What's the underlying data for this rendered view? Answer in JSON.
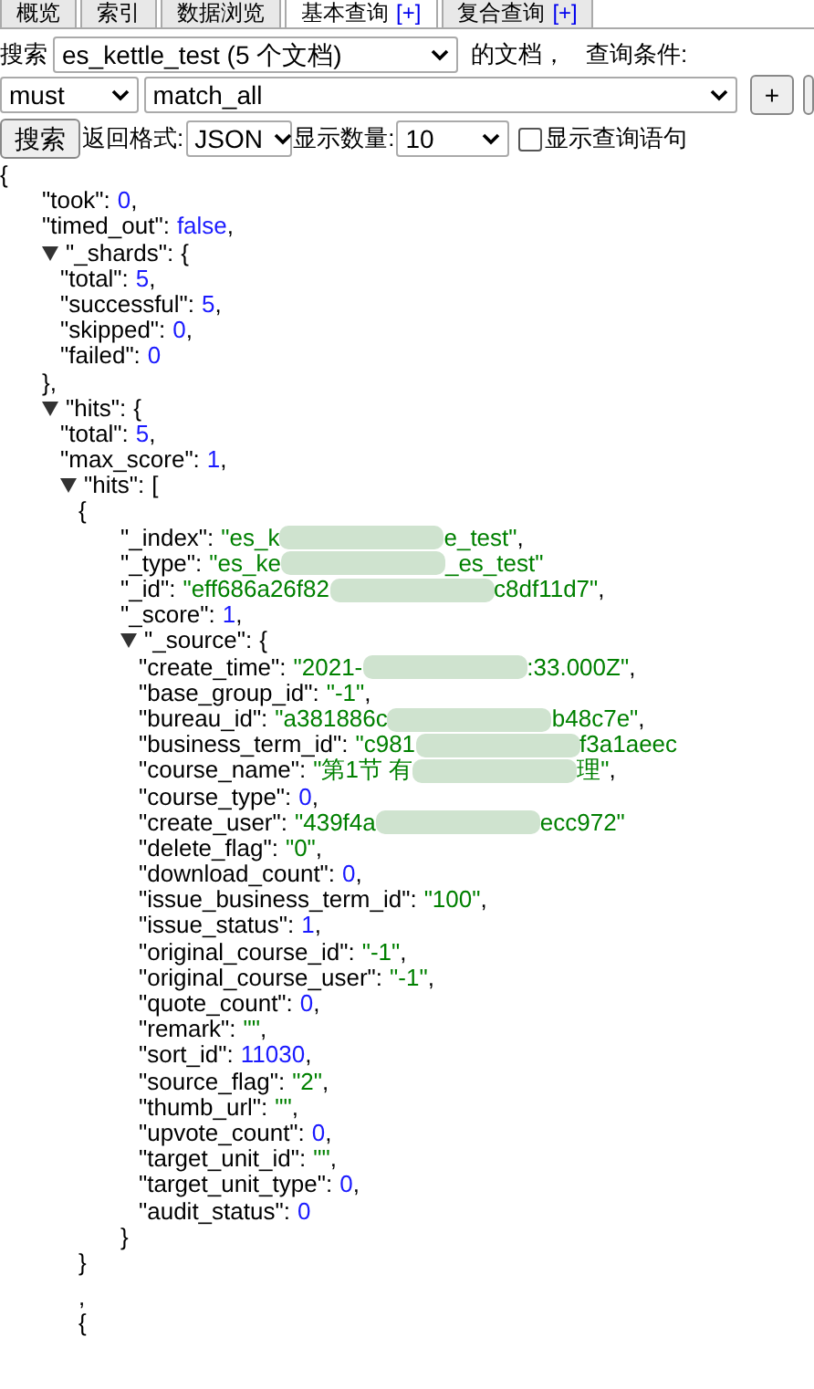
{
  "tabs": [
    {
      "label": "概览",
      "selected": false
    },
    {
      "label": "索引",
      "selected": false
    },
    {
      "label": "数据浏览",
      "selected": false
    },
    {
      "label": "基本查询",
      "plus": "[+]",
      "selected": true
    },
    {
      "label": "复合查询",
      "plus": "[+]",
      "selected": false
    }
  ],
  "search_row": {
    "label": "搜索",
    "index_select": "es_kettle_test (5 个文档)",
    "suffix": "的文档，",
    "condition_label": "查询条件:"
  },
  "condition_row": {
    "occur_select": "must",
    "query_select": "match_all",
    "add_button": "+"
  },
  "options_row": {
    "search_button": "搜索",
    "format_label": "返回格式:",
    "format_select": "JSON",
    "size_label": "显示数量:",
    "size_select": "10",
    "show_query": {
      "label": "显示查询语句",
      "checked": false
    }
  },
  "result": {
    "kind": "object",
    "open": "{",
    "children": [
      {
        "kind": "number",
        "key": "\"took\":",
        "value": "0",
        "after": ","
      },
      {
        "kind": "boolean",
        "key": "\"timed_out\":",
        "value": "false",
        "after": ","
      },
      {
        "kind": "object",
        "key": "\"_shards\":",
        "open": "{",
        "expanded": true,
        "close": "},",
        "children": [
          {
            "kind": "number",
            "key": "\"total\":",
            "value": "5",
            "after": ","
          },
          {
            "kind": "number",
            "key": "\"successful\":",
            "value": "5",
            "after": ","
          },
          {
            "kind": "number",
            "key": "\"skipped\":",
            "value": "0",
            "after": ","
          },
          {
            "kind": "number",
            "key": "\"failed\":",
            "value": "0"
          }
        ]
      },
      {
        "kind": "object",
        "key": "\"hits\":",
        "open": "{",
        "expanded": true,
        "children": [
          {
            "kind": "number",
            "key": "\"total\":",
            "value": "5",
            "after": ","
          },
          {
            "kind": "number",
            "key": "\"max_score\":",
            "value": "1",
            "after": ","
          },
          {
            "kind": "object",
            "key": "\"hits\":",
            "open": "[",
            "expanded": true,
            "children": [
              {
                "kind": "object",
                "open": "{",
                "close": "}",
                "children": [
                  {
                    "kind": "string",
                    "key": "\"_index\":",
                    "value": "\"es_k",
                    "redacted": true,
                    "value_tail": "e_test\"",
                    "after": ","
                  },
                  {
                    "kind": "string",
                    "key": "\"_type\":",
                    "value": "\"es_ke",
                    "redacted": true,
                    "value_tail": "_es_test\""
                  },
                  {
                    "kind": "string",
                    "key": "\"_id\":",
                    "value": "\"eff686a26f82",
                    "redacted": true,
                    "value_tail": "c8df11d7\"",
                    "after": ","
                  },
                  {
                    "kind": "number",
                    "key": "\"_score\":",
                    "value": "1",
                    "after": ","
                  },
                  {
                    "kind": "object",
                    "key": "\"_source\":",
                    "open": "{",
                    "expanded": true,
                    "close": "}",
                    "children": [
                      {
                        "kind": "string",
                        "key": "\"create_time\":",
                        "value": "\"2021-",
                        "redacted": true,
                        "value_tail": ":33.000Z\"",
                        "after": ","
                      },
                      {
                        "kind": "string",
                        "key": "\"base_group_id\":",
                        "value": "\"-1\"",
                        "after": ","
                      },
                      {
                        "kind": "string",
                        "key": "\"bureau_id\":",
                        "value": "\"a381886c",
                        "redacted": true,
                        "value_tail": "b48c7e\"",
                        "after": ","
                      },
                      {
                        "kind": "string",
                        "key": "\"business_term_id\":",
                        "value": "\"c981",
                        "redacted": true,
                        "value_tail": "f3a1aeec"
                      },
                      {
                        "kind": "string",
                        "key": "\"course_name\":",
                        "value": "\"第1节 有",
                        "redacted": true,
                        "value_tail": "理\"",
                        "after": ","
                      },
                      {
                        "kind": "number",
                        "key": "\"course_type\":",
                        "value": "0",
                        "after": ","
                      },
                      {
                        "kind": "string",
                        "key": "\"create_user\":",
                        "value": "\"439f4a",
                        "redacted": true,
                        "value_tail": "ecc972\""
                      },
                      {
                        "kind": "string",
                        "key": "\"delete_flag\":",
                        "value": "\"0\"",
                        "after": ","
                      },
                      {
                        "kind": "number",
                        "key": "\"download_count\":",
                        "value": "0",
                        "after": ","
                      },
                      {
                        "kind": "string",
                        "key": "\"issue_business_term_id\":",
                        "value": "\"100\"",
                        "after": ","
                      },
                      {
                        "kind": "number",
                        "key": "\"issue_status\":",
                        "value": "1",
                        "after": ","
                      },
                      {
                        "kind": "string",
                        "key": "\"original_course_id\":",
                        "value": "\"-1\"",
                        "after": ","
                      },
                      {
                        "kind": "string",
                        "key": "\"original_course_user\":",
                        "value": "\"-1\"",
                        "after": ","
                      },
                      {
                        "kind": "number",
                        "key": "\"quote_count\":",
                        "value": "0",
                        "after": ","
                      },
                      {
                        "kind": "string",
                        "key": "\"remark\":",
                        "value": "\"\"",
                        "after": ","
                      },
                      {
                        "kind": "number",
                        "key": "\"sort_id\":",
                        "value": "11030",
                        "after": ","
                      },
                      {
                        "kind": "string",
                        "key": "\"source_flag\":",
                        "value": "\"2\"",
                        "after": ","
                      },
                      {
                        "kind": "string",
                        "key": "\"thumb_url\":",
                        "value": "\"\"",
                        "after": ","
                      },
                      {
                        "kind": "number",
                        "key": "\"upvote_count\":",
                        "value": "0",
                        "after": ","
                      },
                      {
                        "kind": "string",
                        "key": "\"target_unit_id\":",
                        "value": "\"\"",
                        "after": ","
                      },
                      {
                        "kind": "number",
                        "key": "\"target_unit_type\":",
                        "value": "0",
                        "after": ","
                      },
                      {
                        "kind": "number",
                        "key": "\"audit_status\":",
                        "value": "0"
                      }
                    ]
                  }
                ]
              },
              {
                "kind": "separator",
                "text": ","
              },
              {
                "kind": "object",
                "open": "{"
              }
            ]
          }
        ]
      }
    ]
  }
}
